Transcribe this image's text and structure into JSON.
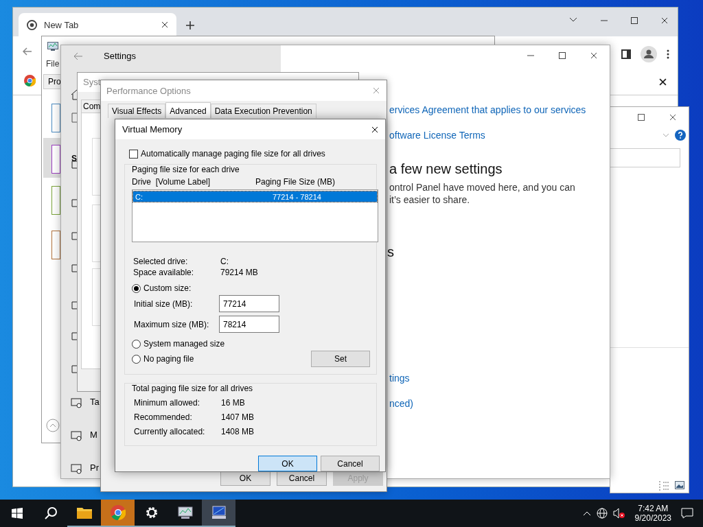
{
  "chrome": {
    "tab": "New Tab"
  },
  "task_manager": {
    "menu": "File",
    "tab": "Pro"
  },
  "settings": {
    "title": "Settings",
    "section": "S",
    "nav_labels": [
      "Ta",
      "M",
      "Pr"
    ],
    "links": [
      "ervices Agreement that applies to our services",
      "oftware License Terms"
    ],
    "heading": "a few new settings",
    "paragraph": [
      "ontrol Panel have moved here, and you can",
      "it’s easier to share."
    ],
    "heading_2": "s",
    "links_2": [
      "tings",
      "nced)"
    ]
  },
  "system_properties": {
    "title": "Syst",
    "tab": "Com"
  },
  "performance_options": {
    "title": "Performance Options",
    "tabs": [
      {
        "label": "Visual Effects",
        "selected": false
      },
      {
        "label": "Advanced",
        "selected": true
      },
      {
        "label": "Data Execution Prevention",
        "selected": false
      }
    ],
    "buttons": [
      {
        "label": "OK",
        "disabled": false
      },
      {
        "label": "Cancel",
        "disabled": false
      },
      {
        "label": "Apply",
        "disabled": true
      }
    ]
  },
  "virtual_memory": {
    "title": "Virtual Memory",
    "auto_manage": {
      "label": "Automatically manage paging file size for all drives",
      "checked": false
    },
    "group_title": "Paging file size for each drive",
    "columns": [
      "Drive  [Volume Label]",
      "Paging File Size (MB)"
    ],
    "rows": [
      {
        "drive": "C:",
        "size": "77214 - 78214",
        "selected": true
      }
    ],
    "info": [
      {
        "label": "Selected drive:",
        "value": "C:"
      },
      {
        "label": "Space available:",
        "value": "79214 MB"
      }
    ],
    "radios": [
      {
        "label": "Custom size:",
        "selected": true
      },
      {
        "label": "System managed size",
        "selected": false
      },
      {
        "label": "No paging file",
        "selected": false
      }
    ],
    "fields": [
      {
        "label": "Initial size (MB):",
        "value": "77214"
      },
      {
        "label": "Maximum size (MB):",
        "value": "78214"
      }
    ],
    "set_button": "Set",
    "totals_title": "Total paging file size for all drives",
    "totals": [
      {
        "label": "Minimum allowed:",
        "value": "16 MB"
      },
      {
        "label": "Recommended:",
        "value": "1407 MB"
      },
      {
        "label": "Currently allocated:",
        "value": "1408 MB"
      }
    ],
    "buttons": [
      {
        "label": "OK",
        "default": true
      },
      {
        "label": "Cancel",
        "default": false
      }
    ]
  },
  "taskbar": {
    "apps": [
      {
        "running": true,
        "active": false,
        "flashing": false
      },
      {
        "running": true,
        "active": false,
        "flashing": true
      },
      {
        "running": true,
        "active": false,
        "flashing": false
      },
      {
        "running": true,
        "active": false,
        "flashing": false
      },
      {
        "running": true,
        "active": true,
        "flashing": false
      }
    ],
    "time": "7:42 AM",
    "date": "9/20/2023"
  }
}
